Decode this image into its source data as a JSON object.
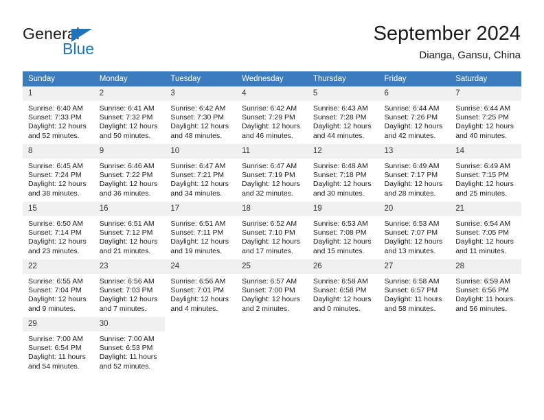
{
  "brand": {
    "name_part1": "General",
    "name_part2": "Blue",
    "accent_color": "#1e74bb"
  },
  "header": {
    "title": "September 2024",
    "location": "Dianga, Gansu, China",
    "header_bg_color": "#3b7cbf"
  },
  "weekday_headers": [
    "Sunday",
    "Monday",
    "Tuesday",
    "Wednesday",
    "Thursday",
    "Friday",
    "Saturday"
  ],
  "weeks": [
    [
      {
        "day": "1",
        "sunrise": "Sunrise: 6:40 AM",
        "sunset": "Sunset: 7:33 PM",
        "daylight_line1": "Daylight: 12 hours",
        "daylight_line2": "and 52 minutes."
      },
      {
        "day": "2",
        "sunrise": "Sunrise: 6:41 AM",
        "sunset": "Sunset: 7:32 PM",
        "daylight_line1": "Daylight: 12 hours",
        "daylight_line2": "and 50 minutes."
      },
      {
        "day": "3",
        "sunrise": "Sunrise: 6:42 AM",
        "sunset": "Sunset: 7:30 PM",
        "daylight_line1": "Daylight: 12 hours",
        "daylight_line2": "and 48 minutes."
      },
      {
        "day": "4",
        "sunrise": "Sunrise: 6:42 AM",
        "sunset": "Sunset: 7:29 PM",
        "daylight_line1": "Daylight: 12 hours",
        "daylight_line2": "and 46 minutes."
      },
      {
        "day": "5",
        "sunrise": "Sunrise: 6:43 AM",
        "sunset": "Sunset: 7:28 PM",
        "daylight_line1": "Daylight: 12 hours",
        "daylight_line2": "and 44 minutes."
      },
      {
        "day": "6",
        "sunrise": "Sunrise: 6:44 AM",
        "sunset": "Sunset: 7:26 PM",
        "daylight_line1": "Daylight: 12 hours",
        "daylight_line2": "and 42 minutes."
      },
      {
        "day": "7",
        "sunrise": "Sunrise: 6:44 AM",
        "sunset": "Sunset: 7:25 PM",
        "daylight_line1": "Daylight: 12 hours",
        "daylight_line2": "and 40 minutes."
      }
    ],
    [
      {
        "day": "8",
        "sunrise": "Sunrise: 6:45 AM",
        "sunset": "Sunset: 7:24 PM",
        "daylight_line1": "Daylight: 12 hours",
        "daylight_line2": "and 38 minutes."
      },
      {
        "day": "9",
        "sunrise": "Sunrise: 6:46 AM",
        "sunset": "Sunset: 7:22 PM",
        "daylight_line1": "Daylight: 12 hours",
        "daylight_line2": "and 36 minutes."
      },
      {
        "day": "10",
        "sunrise": "Sunrise: 6:47 AM",
        "sunset": "Sunset: 7:21 PM",
        "daylight_line1": "Daylight: 12 hours",
        "daylight_line2": "and 34 minutes."
      },
      {
        "day": "11",
        "sunrise": "Sunrise: 6:47 AM",
        "sunset": "Sunset: 7:19 PM",
        "daylight_line1": "Daylight: 12 hours",
        "daylight_line2": "and 32 minutes."
      },
      {
        "day": "12",
        "sunrise": "Sunrise: 6:48 AM",
        "sunset": "Sunset: 7:18 PM",
        "daylight_line1": "Daylight: 12 hours",
        "daylight_line2": "and 30 minutes."
      },
      {
        "day": "13",
        "sunrise": "Sunrise: 6:49 AM",
        "sunset": "Sunset: 7:17 PM",
        "daylight_line1": "Daylight: 12 hours",
        "daylight_line2": "and 28 minutes."
      },
      {
        "day": "14",
        "sunrise": "Sunrise: 6:49 AM",
        "sunset": "Sunset: 7:15 PM",
        "daylight_line1": "Daylight: 12 hours",
        "daylight_line2": "and 25 minutes."
      }
    ],
    [
      {
        "day": "15",
        "sunrise": "Sunrise: 6:50 AM",
        "sunset": "Sunset: 7:14 PM",
        "daylight_line1": "Daylight: 12 hours",
        "daylight_line2": "and 23 minutes."
      },
      {
        "day": "16",
        "sunrise": "Sunrise: 6:51 AM",
        "sunset": "Sunset: 7:12 PM",
        "daylight_line1": "Daylight: 12 hours",
        "daylight_line2": "and 21 minutes."
      },
      {
        "day": "17",
        "sunrise": "Sunrise: 6:51 AM",
        "sunset": "Sunset: 7:11 PM",
        "daylight_line1": "Daylight: 12 hours",
        "daylight_line2": "and 19 minutes."
      },
      {
        "day": "18",
        "sunrise": "Sunrise: 6:52 AM",
        "sunset": "Sunset: 7:10 PM",
        "daylight_line1": "Daylight: 12 hours",
        "daylight_line2": "and 17 minutes."
      },
      {
        "day": "19",
        "sunrise": "Sunrise: 6:53 AM",
        "sunset": "Sunset: 7:08 PM",
        "daylight_line1": "Daylight: 12 hours",
        "daylight_line2": "and 15 minutes."
      },
      {
        "day": "20",
        "sunrise": "Sunrise: 6:53 AM",
        "sunset": "Sunset: 7:07 PM",
        "daylight_line1": "Daylight: 12 hours",
        "daylight_line2": "and 13 minutes."
      },
      {
        "day": "21",
        "sunrise": "Sunrise: 6:54 AM",
        "sunset": "Sunset: 7:05 PM",
        "daylight_line1": "Daylight: 12 hours",
        "daylight_line2": "and 11 minutes."
      }
    ],
    [
      {
        "day": "22",
        "sunrise": "Sunrise: 6:55 AM",
        "sunset": "Sunset: 7:04 PM",
        "daylight_line1": "Daylight: 12 hours",
        "daylight_line2": "and 9 minutes."
      },
      {
        "day": "23",
        "sunrise": "Sunrise: 6:56 AM",
        "sunset": "Sunset: 7:03 PM",
        "daylight_line1": "Daylight: 12 hours",
        "daylight_line2": "and 7 minutes."
      },
      {
        "day": "24",
        "sunrise": "Sunrise: 6:56 AM",
        "sunset": "Sunset: 7:01 PM",
        "daylight_line1": "Daylight: 12 hours",
        "daylight_line2": "and 4 minutes."
      },
      {
        "day": "25",
        "sunrise": "Sunrise: 6:57 AM",
        "sunset": "Sunset: 7:00 PM",
        "daylight_line1": "Daylight: 12 hours",
        "daylight_line2": "and 2 minutes."
      },
      {
        "day": "26",
        "sunrise": "Sunrise: 6:58 AM",
        "sunset": "Sunset: 6:58 PM",
        "daylight_line1": "Daylight: 12 hours",
        "daylight_line2": "and 0 minutes."
      },
      {
        "day": "27",
        "sunrise": "Sunrise: 6:58 AM",
        "sunset": "Sunset: 6:57 PM",
        "daylight_line1": "Daylight: 11 hours",
        "daylight_line2": "and 58 minutes."
      },
      {
        "day": "28",
        "sunrise": "Sunrise: 6:59 AM",
        "sunset": "Sunset: 6:56 PM",
        "daylight_line1": "Daylight: 11 hours",
        "daylight_line2": "and 56 minutes."
      }
    ],
    [
      {
        "day": "29",
        "sunrise": "Sunrise: 7:00 AM",
        "sunset": "Sunset: 6:54 PM",
        "daylight_line1": "Daylight: 11 hours",
        "daylight_line2": "and 54 minutes."
      },
      {
        "day": "30",
        "sunrise": "Sunrise: 7:00 AM",
        "sunset": "Sunset: 6:53 PM",
        "daylight_line1": "Daylight: 11 hours",
        "daylight_line2": "and 52 minutes."
      },
      {
        "day": "",
        "sunrise": "",
        "sunset": "",
        "daylight_line1": "",
        "daylight_line2": ""
      },
      {
        "day": "",
        "sunrise": "",
        "sunset": "",
        "daylight_line1": "",
        "daylight_line2": ""
      },
      {
        "day": "",
        "sunrise": "",
        "sunset": "",
        "daylight_line1": "",
        "daylight_line2": ""
      },
      {
        "day": "",
        "sunrise": "",
        "sunset": "",
        "daylight_line1": "",
        "daylight_line2": ""
      },
      {
        "day": "",
        "sunrise": "",
        "sunset": "",
        "daylight_line1": "",
        "daylight_line2": ""
      }
    ]
  ]
}
